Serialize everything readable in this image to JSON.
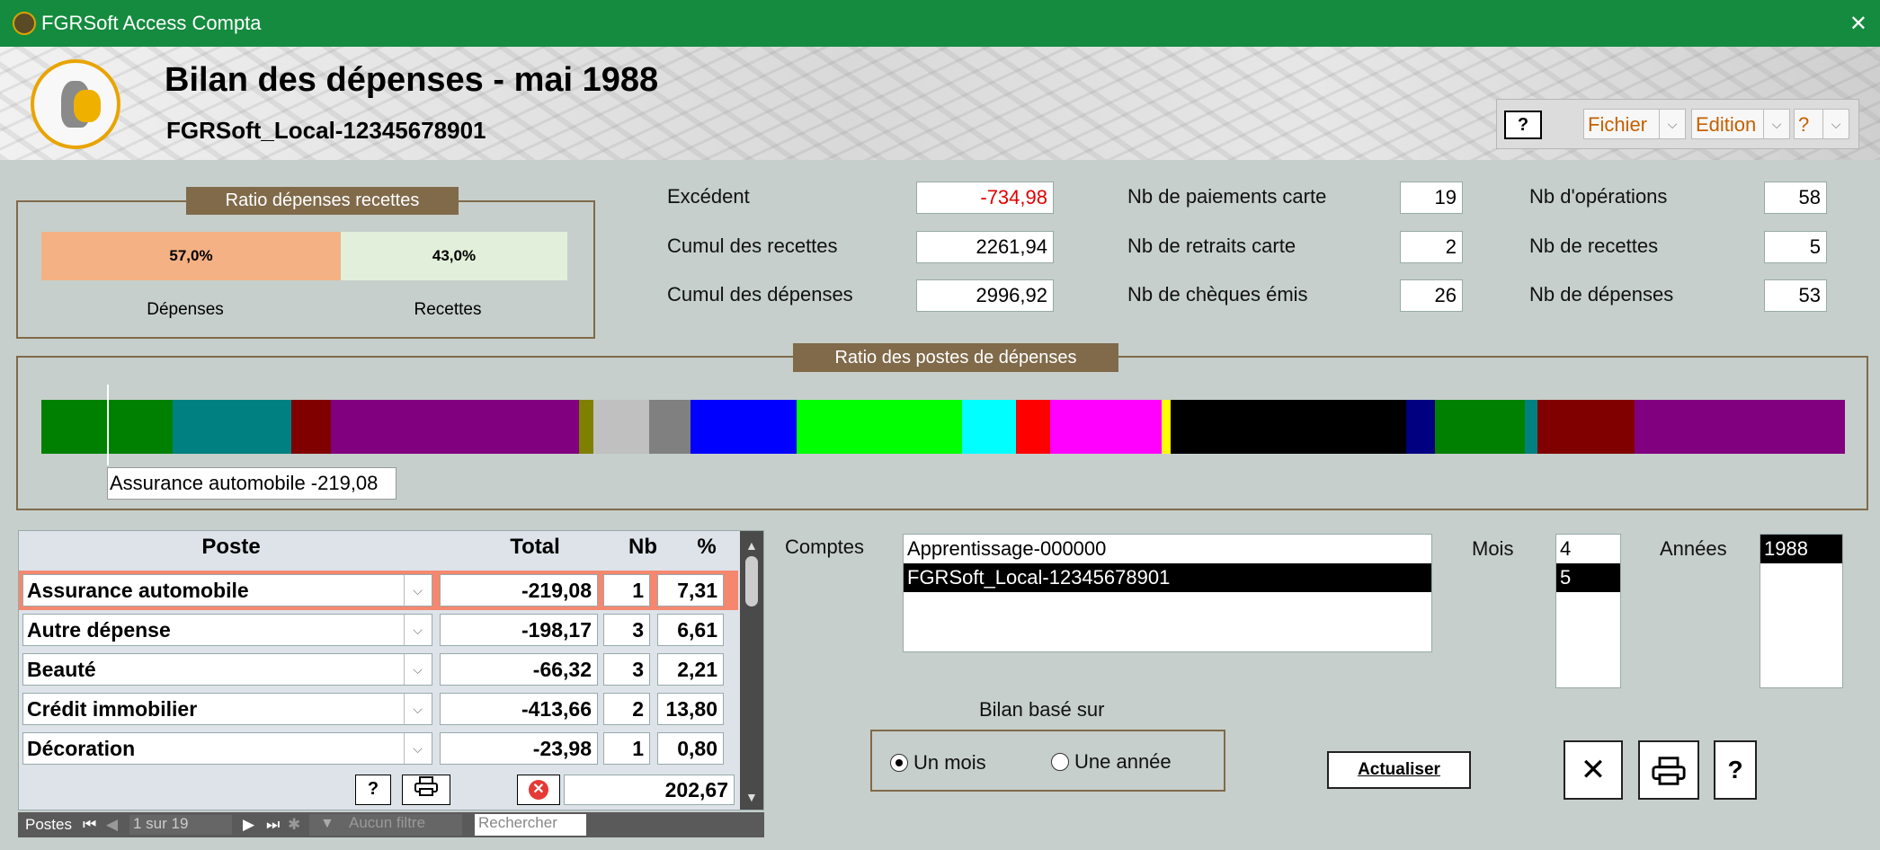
{
  "window": {
    "title": "FGRSoft Access Compta",
    "close": "✕"
  },
  "header": {
    "title": "Bilan des dépenses - mai 1988",
    "subtitle": "FGRSoft_Local-12345678901"
  },
  "menu": {
    "help_button": "?",
    "items": [
      "Fichier",
      "Edition",
      "?"
    ]
  },
  "ratio_dr": {
    "title": "Ratio dépenses recettes",
    "depenses_pct": "57,0%",
    "recettes_pct": "43,0%",
    "depenses_fraction": 0.57,
    "depenses_label": "Dépenses",
    "recettes_label": "Recettes",
    "colors": {
      "depenses": "#f4b183",
      "recettes": "#e2efda"
    }
  },
  "stats": {
    "excedent_label": "Excédent",
    "excedent_value": "-734,98",
    "recettes_label": "Cumul des recettes",
    "recettes_value": "2261,94",
    "depenses_label": "Cumul des dépenses",
    "depenses_value": "2996,92",
    "paiements_label": "Nb de paiements carte",
    "paiements_value": "19",
    "retraits_label": "Nb de retraits carte",
    "retraits_value": "2",
    "cheques_label": "Nb de chèques émis",
    "cheques_value": "26",
    "operations_label": "Nb d'opérations",
    "operations_value": "58",
    "nb_recettes_label": "Nb de recettes",
    "nb_recettes_value": "5",
    "nb_depenses_label": "Nb de dépenses",
    "nb_depenses_value": "53"
  },
  "postes_ratio": {
    "title": "Ratio des postes de dépenses",
    "tooltip": "Assurance automobile  -219,08",
    "segments": [
      {
        "color": "#008000",
        "value": 7.31
      },
      {
        "color": "#008080",
        "value": 6.61
      },
      {
        "color": "#800000",
        "value": 2.21
      },
      {
        "color": "#800080",
        "value": 13.8
      },
      {
        "color": "#808000",
        "value": 0.8
      },
      {
        "color": "#c0c0c0",
        "value": 3.1
      },
      {
        "color": "#808080",
        "value": 2.3
      },
      {
        "color": "#0000ff",
        "value": 5.9
      },
      {
        "color": "#00ff00",
        "value": 9.2
      },
      {
        "color": "#00ffff",
        "value": 3.0
      },
      {
        "color": "#ff0000",
        "value": 1.9
      },
      {
        "color": "#ff00ff",
        "value": 6.2
      },
      {
        "color": "#ffff00",
        "value": 0.5
      },
      {
        "color": "#000000",
        "value": 13.1
      },
      {
        "color": "#000080",
        "value": 1.6
      },
      {
        "color": "#008000",
        "value": 5.0
      },
      {
        "color": "#008080",
        "value": 0.7
      },
      {
        "color": "#800000",
        "value": 5.4
      },
      {
        "color": "#800080",
        "value": 11.5
      }
    ]
  },
  "postes_grid": {
    "headers": {
      "poste": "Poste",
      "total": "Total",
      "nb": "Nb",
      "pct": "%"
    },
    "rows": [
      {
        "poste": "Assurance automobile",
        "total": "-219,08",
        "nb": "1",
        "pct": "7,31"
      },
      {
        "poste": "Autre dépense",
        "total": "-198,17",
        "nb": "3",
        "pct": "6,61"
      },
      {
        "poste": "Beauté",
        "total": "-66,32",
        "nb": "3",
        "pct": "2,21"
      },
      {
        "poste": "Crédit immobilier",
        "total": "-413,66",
        "nb": "2",
        "pct": "13,80"
      },
      {
        "poste": "Décoration",
        "total": "-23,98",
        "nb": "1",
        "pct": "0,80"
      }
    ],
    "footer_total": "202,67",
    "footer_help": "?",
    "nav": {
      "label": "Postes",
      "record": "1 sur 19",
      "filter": "Aucun filtre",
      "search": "Rechercher"
    }
  },
  "comptes": {
    "label": "Comptes",
    "items": [
      "Apprentissage-000000",
      "FGRSoft_Local-12345678901"
    ],
    "selected": 1
  },
  "mois": {
    "label": "Mois",
    "items": [
      "4",
      "5"
    ],
    "selected": 1
  },
  "annees": {
    "label": "Années",
    "items": [
      "1988"
    ],
    "selected": 0
  },
  "bilan": {
    "label": "Bilan basé sur",
    "option_mois": "Un mois",
    "option_annee": "Une année",
    "selected": "mois"
  },
  "actions": {
    "actualiser": "Actualiser",
    "close": "✕",
    "help": "?"
  }
}
